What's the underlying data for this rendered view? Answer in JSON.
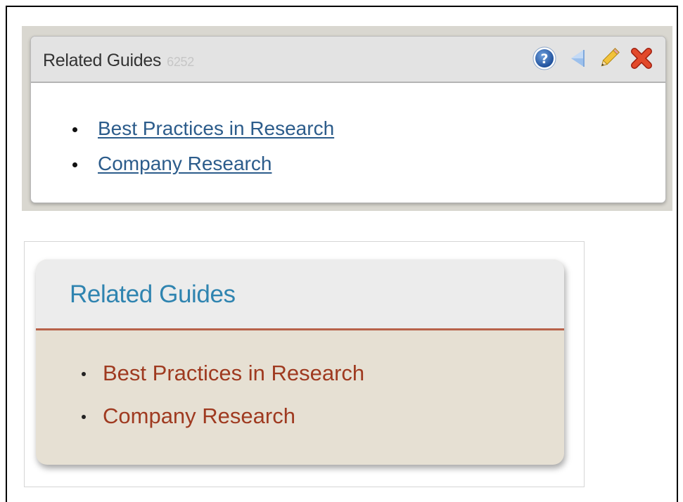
{
  "edit_widget": {
    "title": "Related Guides",
    "guide_id": "6252",
    "icons": [
      "help-icon",
      "arrow-left-icon",
      "pencil-icon",
      "delete-icon"
    ],
    "links": [
      "Best Practices in Research",
      "Company Research"
    ]
  },
  "public_widget": {
    "title": "Related Guides",
    "links": [
      "Best Practices in Research",
      "Company Research"
    ]
  },
  "colors": {
    "edit_link": "#2c5c8b",
    "public_title": "#2f84b0",
    "public_link": "#9f3a20",
    "public_accent": "#b8624a",
    "public_body": "#e6e0d3"
  }
}
